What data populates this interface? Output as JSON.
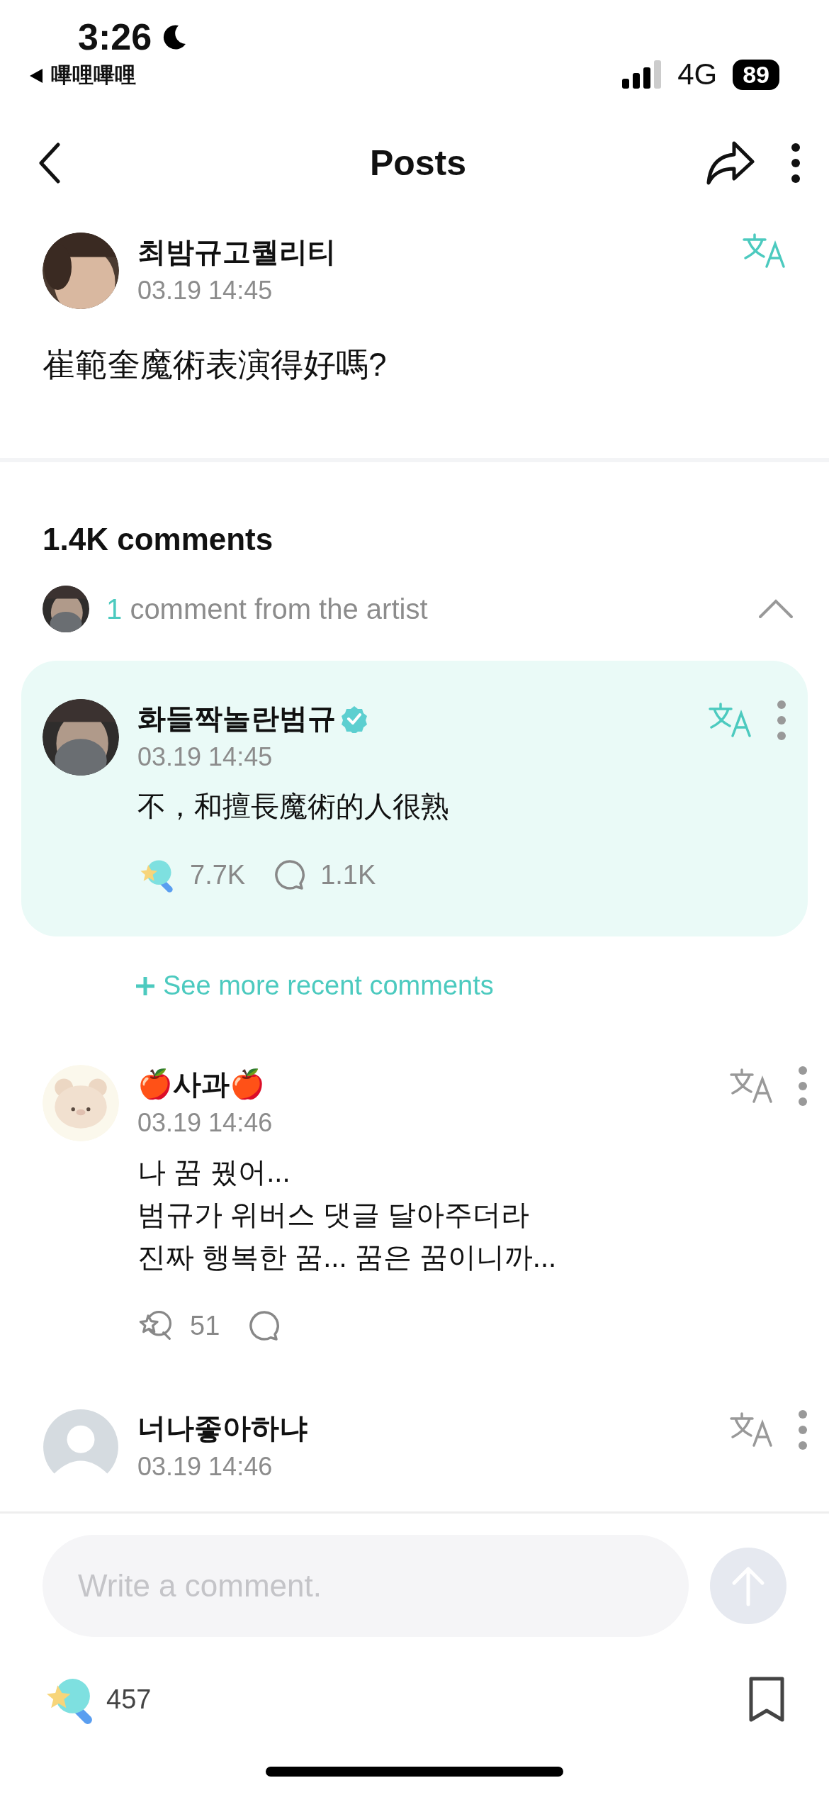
{
  "status_bar": {
    "time": "3:26",
    "back_app": "嗶哩嗶哩",
    "network": "4G",
    "battery": "89"
  },
  "nav": {
    "title": "Posts"
  },
  "post": {
    "author": "최밤규고퀄리티",
    "time": "03.19 14:45",
    "text": "崔範奎魔術表演得好嗎?"
  },
  "comments_count": "1.4K comments",
  "artist_section": {
    "count": "1",
    "label": "comment from the artist",
    "expanded": true
  },
  "artist_comment": {
    "name": "화들짝놀란범규",
    "verified": true,
    "time": "03.19 14:45",
    "text": "不，和擅長魔術的人很熟",
    "likes": "7.7K",
    "liked": true,
    "replies": "1.1K"
  },
  "see_more": "See more recent comments",
  "comments": [
    {
      "name": "🍎사과🍎",
      "time": "03.19 14:46",
      "text": "나 꿈 꿨어...\n범규가 위버스 댓글 달아주더라\n진짜 행복한 꿈... 꿈은 꿈이니까...",
      "likes": "51",
      "liked": false
    },
    {
      "name": "너나좋아하냐",
      "avatar": {
        "kind": "default"
      },
      "time": "03.19 14:46"
    }
  ],
  "composer": {
    "placeholder": "Write a comment."
  },
  "footer": {
    "likes": "457",
    "liked": true,
    "bookmarked": false
  }
}
